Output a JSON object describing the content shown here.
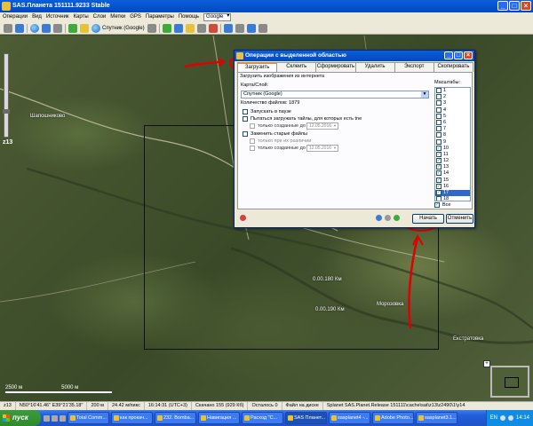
{
  "window": {
    "title": "SAS.Планета 151111.9233 Stable"
  },
  "menu": [
    "Операции",
    "Вид",
    "Источник",
    "Карты",
    "Слои",
    "Метки",
    "GPS",
    "Параметры",
    "Помощь"
  ],
  "menu_select": "Google",
  "toolbar": {
    "layer_label": "Спутник (Google)"
  },
  "map": {
    "zoom_label": "z13",
    "scale_label_left": "2500 м",
    "scale_label_right": "5000 м",
    "labels": [
      "Шапошниково",
      "Морозовка",
      "Екстратовка",
      "0.00.190 Км",
      "0.00.180 Км"
    ]
  },
  "dialog": {
    "title": "Операции с выделенной областью",
    "tabs": [
      "Загрузить",
      "Склеить",
      "Сформировать",
      "Удалить",
      "Экспорт",
      "Скопировать"
    ],
    "section_title": "Загрузить изображения из интернета",
    "map_layer_label": "Карта/Слой:",
    "map_layer_value": "Спутник (Google)",
    "files_count": "Количество файлов: 1879",
    "opt_pause": "Запускать в паузе",
    "opt_try_loaded": "Пытаться загружать тайлы, для которых есть tne",
    "opt_only_created_1": "только созданные до",
    "opt_replace_old": "Заменить старые файлы",
    "opt_only_if_diff": "только при их различии",
    "opt_only_created_2": "только созданные до",
    "date_value": "12.05.2016",
    "scales_label": "Масштабы:",
    "scales": [
      "1",
      "2",
      "3",
      "4",
      "5",
      "6",
      "7",
      "8",
      "9",
      "10",
      "11",
      "12",
      "13",
      "14",
      "15",
      "16",
      "17",
      "18"
    ],
    "scales_checked": [
      false,
      false,
      false,
      false,
      false,
      false,
      false,
      false,
      false,
      true,
      true,
      true,
      true,
      true,
      true,
      true,
      true,
      false
    ],
    "scales_selected_index": 16,
    "all_label": "Все",
    "start_button": "Начать",
    "cancel_button": "Отменить"
  },
  "status": [
    "z13",
    "N50°16'41.46\" E39°21'35.18\"",
    "200 м",
    "24.42 м/пикс",
    "16:14:31 (UTC+3)",
    "Скачано 155 (929 Кб)",
    "Осталось 0",
    "Файл на диске",
    "Splanet SAS.Planet.Release 151111\\cache\\sat\\z13\\z2490\\1\\y14"
  ],
  "taskbar": {
    "start": "пуск",
    "tasks": [
      "Total Comm...",
      "как прокач...",
      "232. Bomba...",
      "Навигация ...",
      "Расход \"С...",
      "SAS Планет...",
      "sasplanet4 -...",
      "Adobe Photo...",
      "sasplanet3.1..."
    ],
    "active_task_index": 5,
    "lang": "EN",
    "clock": "14:14"
  }
}
